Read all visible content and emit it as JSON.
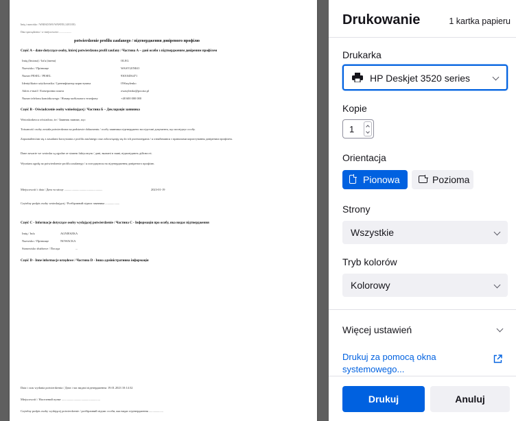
{
  "panel": {
    "title": "Drukowanie",
    "sheet_count": "1 kartka papieru",
    "printer_label": "Drukarka",
    "printer_value": "HP Deskjet 3520 series",
    "copies_label": "Kopie",
    "copies_value": "1",
    "orientation_label": "Orientacja",
    "orientation_portrait": "Pionowa",
    "orientation_landscape": "Pozioma",
    "orientation_selected": "Pionowa",
    "pages_label": "Strony",
    "pages_value": "Wszystkie",
    "color_label": "Tryb kolorów",
    "color_value": "Kolorowy",
    "more_settings": "Więcej ustawień",
    "system_dialog": "Drukuj za pomocą okna systemowego...",
    "print_button": "Drukuj",
    "cancel_button": "Anuluj",
    "accent_color": "#0061e0"
  },
  "preview": {
    "header1": "Imię i nazwisko / WARSZAWA WAWER (1401100)",
    "header2": "Data sporządzenia / w miejscowości ...................",
    "title": "potwierdzenie profilu zaufanego / підтвердження довіреного профілю",
    "sectionA": "Część A – dane dotyczące osoby, której potwierdzono profil zaufany / Частина А – дані особи з підтвердженим довіреним профілем",
    "rows": [
      {
        "label": "Imię (Imiona) / Ім'я (імена)",
        "value": "OLEG"
      },
      {
        "label": "Nazwisko / Прізвище",
        "value": "WASYLENKO"
      },
      {
        "label": "Numer PESEL / PESEL",
        "value": "93010456471"
      },
      {
        "label": "Identyfikator użytkownika / Ідентифікатор користувача",
        "value": "OWasylenko"
      },
      {
        "label": "Adres e-mail / Електронна пошта",
        "value": "owasylenko@poczta.pl"
      },
      {
        "label": "Numer telefonu komórkowego / Номер мобільного телефону",
        "value": "+48 600 000 000"
      }
    ],
    "sectionB": "Część B - Oświadczenie osoby wnioskującej / Частина Б – Декларація заявника",
    "b_lines": [
      "Wnioskodawca oświadcza, że / Заявник заявляє, що:",
      "Tożsamość osoby została potwierdzona na podstawie dokumentu / особу заявника підтверджено на підставі документа, що посвідчує особу.",
      "Zapoznałem/am się z zasadami korzystania z profilu zaufanego oraz zobowiązuję się do ich przestrzegania / я ознайомився з правилами користування довіреним профілем.",
      "Dane zawarte we wniosku są zgodne ze stanem faktycznym / дані, вказані в заяві, відповідають дійсності.",
      "Wyrażam zgodę na potwierdzenie profilu zaufanego / я погоджуюся на підтвердження довіреного профілю."
    ],
    "date_line": "Miejscowość i data / Дата та місце ...................................................",
    "date_value": "2023-01-19",
    "sign_line": "Czytelny podpis osoby wnioskującej / Розбірливий підпис заявника ...................",
    "sectionC": "Część C - Informacje dotyczące osoby wydającej potwierdzenie / Частина С - Інформація про особу, яка видає підтвердження",
    "c_rows": [
      {
        "label": "Imię / Ім'я",
        "value": "AGNIESZKA"
      },
      {
        "label": "Nazwisko / Прізвище",
        "value": "NOWACKA"
      },
      {
        "label": "Stanowisko służbowe / Посада",
        "value": "..."
      }
    ],
    "sectionD": "Część D - Inne informacje urzędowe / Частина D - Інша адміністративна інформація",
    "footer1": "Data i czas wydania potwierdzenia / Дата і час видачі підтвердження: 19.01.2023 10:14:32",
    "footer2": "Miejscowość / Населений пункт ...................................................",
    "footer3": "Czytelny podpis osoby wydającej potwierdzenie / розбірливий підпис особи, яка видає підтвердження ..................."
  }
}
